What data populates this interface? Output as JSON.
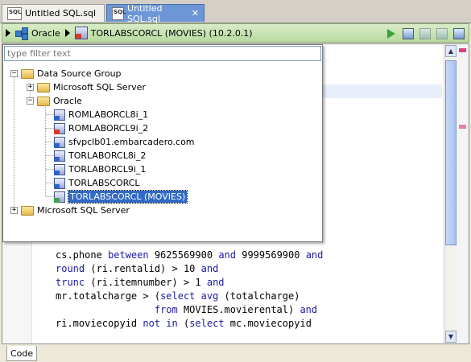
{
  "tabs": [
    {
      "label": "Untitled SQL.sql"
    },
    {
      "label": "Untitled SQL.sql",
      "close": "✕"
    }
  ],
  "toolbar": {
    "platform": "Oracle",
    "connection": "TORLABSCORCL (MOVIES) (10.2.0.1)"
  },
  "filter": {
    "placeholder": "type filter text"
  },
  "tree": {
    "root": "Data Source Group",
    "mssql": "Microsoft SQL Server",
    "oracle": "Oracle",
    "oracle_items": [
      {
        "label": "ROMLABORCL8i_1",
        "status": "blue"
      },
      {
        "label": "ROMLABORCL9i_2",
        "status": "red"
      },
      {
        "label": "sfvpclb01.embarcadero.com",
        "status": "blue"
      },
      {
        "label": "TORLABORCL8i_2",
        "status": "blue"
      },
      {
        "label": "TORLABORCL9i_1",
        "status": "blue"
      },
      {
        "label": "TORLABSCORCL",
        "status": "blue"
      },
      {
        "label": "TORLABSCORCL (MOVIES)",
        "status": "green"
      }
    ],
    "mssql_root": "Microsoft SQL Server"
  },
  "code": {
    "lines": [
      "cs.phone between 9625569900 and 9999569900 and",
      "round (ri.rentalid) > 10 and",
      "trunc (ri.itemnumber) > 1 and",
      "mr.totalcharge > (select avg (totalcharge)",
      "                 from MOVIES.movierental) and",
      "ri.moviecopyid not in (select mc.moviecopyid"
    ]
  },
  "bottom": {
    "code_tab": "Code"
  },
  "colors": {
    "toolbar_green": "#b7dba0",
    "tab_active": "#6d96d6",
    "selection": "#316ac5",
    "keyword": "#1a1aa6"
  }
}
